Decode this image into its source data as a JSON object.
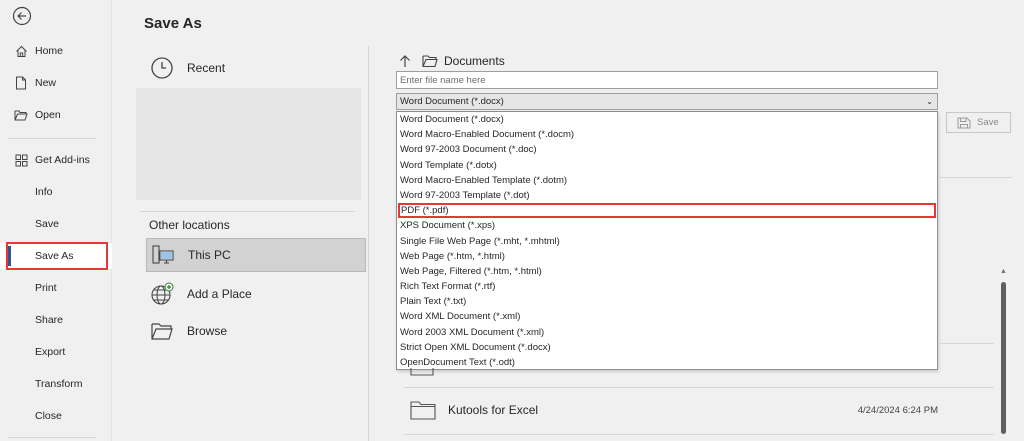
{
  "nav": {
    "items": [
      {
        "label": "Home",
        "icon": "home-icon"
      },
      {
        "label": "New",
        "icon": "new-document-icon"
      },
      {
        "label": "Open",
        "icon": "open-folder-icon"
      },
      {
        "label": "Get Add-ins",
        "icon": "add-ins-grid-icon"
      },
      {
        "label": "Info"
      },
      {
        "label": "Save"
      },
      {
        "label": "Save As"
      },
      {
        "label": "Print"
      },
      {
        "label": "Share"
      },
      {
        "label": "Export"
      },
      {
        "label": "Transform"
      },
      {
        "label": "Close"
      }
    ],
    "selected": "Save As",
    "highlight_color": "#e53935"
  },
  "page": {
    "title": "Save As"
  },
  "locations": {
    "recent_label": "Recent",
    "other_title": "Other locations",
    "items": [
      {
        "label": "This PC",
        "icon": "this-pc-icon",
        "selected": true
      },
      {
        "label": "Add a Place",
        "icon": "globe-add-icon"
      },
      {
        "label": "Browse",
        "icon": "browse-folder-icon"
      }
    ]
  },
  "browser": {
    "path_label": "Documents",
    "filename_placeholder": "Enter file name here",
    "file_type_selected": "Word Document (*.docx)",
    "file_types": [
      "Word Document (*.docx)",
      "Word Macro-Enabled Document (*.docm)",
      "Word 97-2003 Document (*.doc)",
      "Word Template (*.dotx)",
      "Word Macro-Enabled Template (*.dotm)",
      "Word 97-2003 Template (*.dot)",
      "PDF (*.pdf)",
      "XPS Document (*.xps)",
      "Single File Web Page (*.mht, *.mhtml)",
      "Web Page (*.htm, *.html)",
      "Web Page, Filtered (*.htm, *.html)",
      "Rich Text Format (*.rtf)",
      "Plain Text (*.txt)",
      "Word XML Document (*.xml)",
      "Word 2003 XML Document (*.xml)",
      "Strict Open XML Document (*.docx)",
      "OpenDocument Text (*.odt)"
    ],
    "highlighted_type": "PDF (*.pdf)",
    "save_label": "Save",
    "files": [
      {
        "name": "Kutools for Excel",
        "modified": "4/24/2024 6:24 PM",
        "icon": "folder-icon"
      }
    ]
  }
}
